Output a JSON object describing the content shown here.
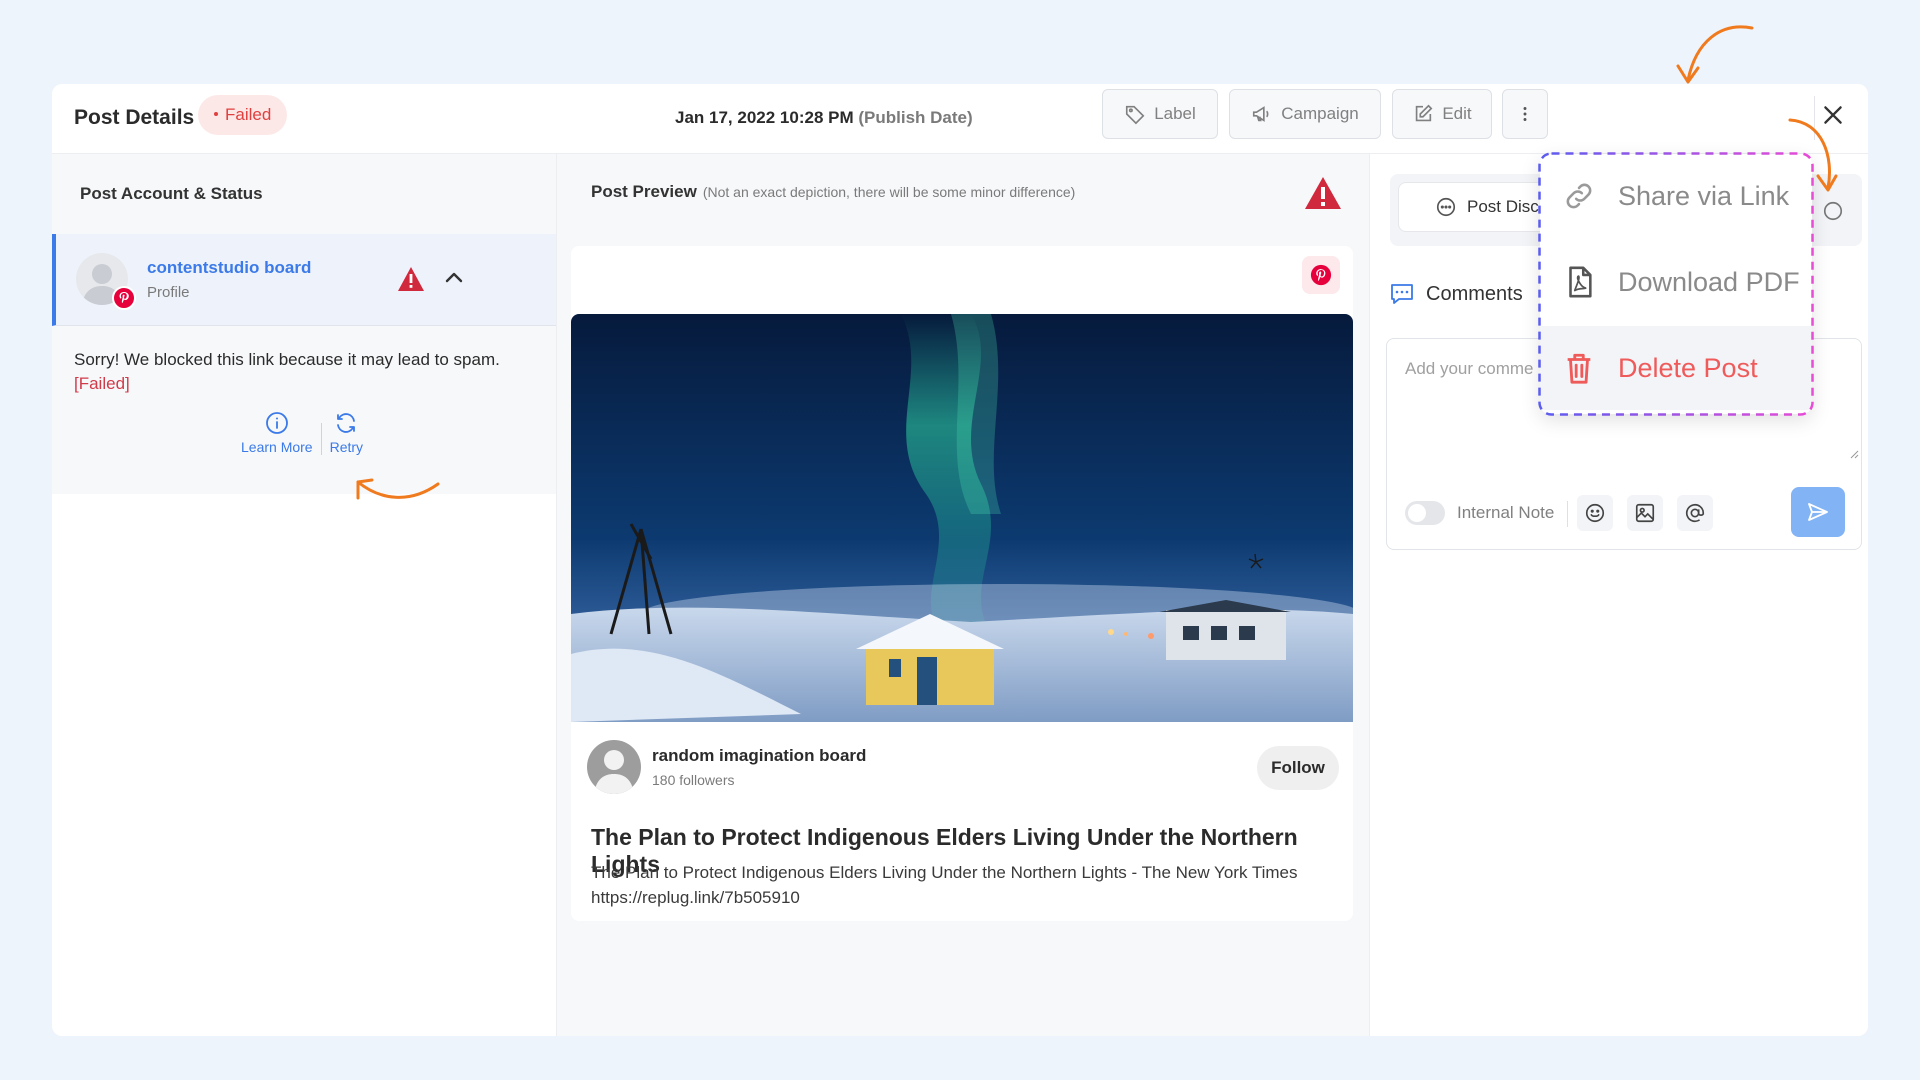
{
  "header": {
    "title": "Post Details",
    "status": "Failed",
    "date": "Jan 17, 2022 10:28 PM",
    "date_suffix": "(Publish Date)",
    "buttons": {
      "label": "Label",
      "campaign": "Campaign",
      "edit": "Edit"
    }
  },
  "left": {
    "section_title": "Post Account & Status",
    "account": {
      "name": "contentstudio board",
      "type": "Profile"
    },
    "error": {
      "message": "Sorry! We blocked this link because it may lead to spam.",
      "tag": "[Failed]",
      "learn_more": "Learn More",
      "retry": "Retry"
    }
  },
  "preview": {
    "title": "Post Preview",
    "note": "(Not an exact depiction, there will be some minor difference)",
    "board_name": "random imagination board",
    "followers": "180 followers",
    "follow_label": "Follow",
    "post_title": "The Plan to Protect Indigenous Elders Living Under the Northern Lights",
    "post_description": "The Plan to Protect Indigenous Elders Living Under the Northern Lights - The New York Times",
    "post_link": "https://replug.link/7b505910"
  },
  "right": {
    "tab_label": "Post Disc",
    "comments_title": "Comments",
    "comment_placeholder": "Add your comme",
    "internal_note": "Internal Note"
  },
  "dropdown": {
    "items": [
      {
        "label": "Share via Link",
        "icon": "link-icon"
      },
      {
        "label": "Download PDF",
        "icon": "pdf-icon"
      },
      {
        "label": "Delete Post",
        "icon": "trash-icon"
      }
    ]
  },
  "colors": {
    "accent": "#3b7ae8",
    "failed": "#e0413f",
    "delete": "#ef5a5a",
    "annotation_arrow": "#f07a1e",
    "pinterest": "#e6003c"
  }
}
